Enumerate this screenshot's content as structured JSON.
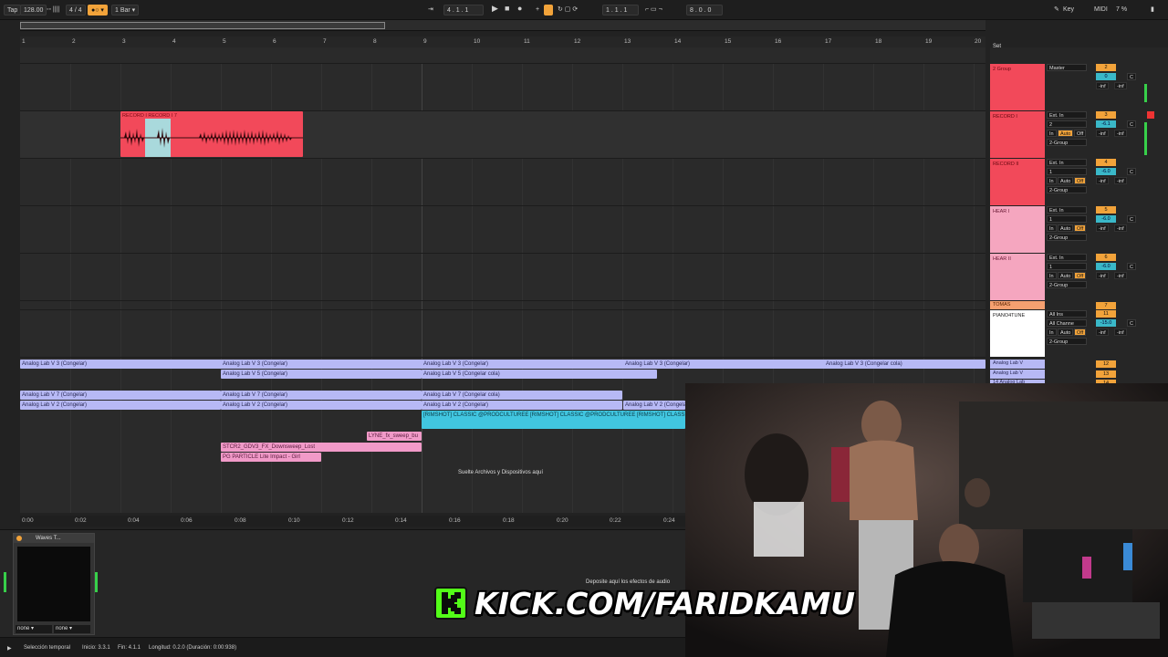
{
  "toolbar": {
    "tap": "Tap",
    "tempo": "128.00",
    "signature": "4 / 4",
    "quantize": "1 Bar",
    "position": "4 .  1 .  1",
    "loop_start": "1 .  1 .  1",
    "loop_length": "8 .  0 .  0",
    "key": "Key",
    "midi": "MIDI",
    "cpu": "7 %"
  },
  "ruler_bars": [
    "1",
    "2",
    "3",
    "4",
    "5",
    "6",
    "7",
    "8",
    "9",
    "10",
    "11",
    "12",
    "13",
    "14",
    "15",
    "16",
    "17",
    "18",
    "19",
    "20"
  ],
  "time_ticks": [
    "0:00",
    "0:02",
    "0:04",
    "0:06",
    "0:08",
    "0:10",
    "0:12",
    "0:14",
    "0:16",
    "0:18",
    "0:20",
    "0:22",
    "0:24"
  ],
  "set_label": "Set",
  "record_clip": {
    "header": "RECORD I RECORD I 7"
  },
  "clips": [
    {
      "text": "Analog Lab V 3 (Congelar)"
    },
    {
      "text": "Analog Lab V 3 (Congelar)"
    },
    {
      "text": "Analog Lab V 3 (Congelar)"
    },
    {
      "text": "Analog Lab V 3 (Congelar)"
    },
    {
      "text": "Analog Lab V 3 (Congelar cola)"
    },
    {
      "text": "Analog Lab V 5 (Congelar)"
    },
    {
      "text": "Analog Lab V 5 (Congelar cola)"
    },
    {
      "text": "Analog Lab V 7 (Congelar)"
    },
    {
      "text": "Analog Lab V 7 (Congelar)"
    },
    {
      "text": "Analog Lab V 7 (Congelar cola)"
    },
    {
      "text": "Analog Lab V 2 (Congelar)"
    },
    {
      "text": "Analog Lab V 2 (Congelar)"
    },
    {
      "text": "Analog Lab V 2 (Congelar)"
    },
    {
      "text": "Analog Lab V 2 (Congelar)"
    },
    {
      "text": "[RIMSHOT] CLASSIC @PRODCULTUREE [RIMSHOT] CLASSIC @PRODCULTUREE [RIMSHOT] CLASSIC @P"
    },
    {
      "text": "LYNE_fx_sweep_bu"
    },
    {
      "text": "STCR2_GDV3_FX_Downsweep_Lost"
    },
    {
      "text": "PG PARTICLE Lite Impact - Girl"
    }
  ],
  "drop_files": "Suelte Archivos y Dispositivos aquí",
  "drop_effects": "Deposite aquí los efectos de audio",
  "tracks": [
    {
      "name": "2 Group",
      "routing": "Master",
      "num": "2",
      "vol": "0",
      "pan": "C",
      "inf1": "-inf",
      "inf2": "-inf"
    },
    {
      "name": "RECORD I",
      "routing": "Ext. In",
      "ch": "2",
      "num": "3",
      "vol": "-6.1",
      "pan": "C",
      "mon_in": "In",
      "mon_auto": "Auto",
      "mon_off": "Off",
      "out": "2-Group",
      "inf1": "-inf",
      "inf2": "-inf"
    },
    {
      "name": "RECORD II",
      "routing": "Ext. In",
      "ch": "1",
      "num": "4",
      "vol": "-6.0",
      "pan": "C",
      "mon_in": "In",
      "mon_auto": "Auto",
      "mon_off": "Off",
      "out": "2-Group",
      "inf1": "-inf",
      "inf2": "-inf"
    },
    {
      "name": "HEAR I",
      "routing": "Ext. In",
      "ch": "1",
      "num": "5",
      "vol": "-6.0",
      "pan": "C",
      "mon_in": "In",
      "mon_auto": "Auto",
      "mon_off": "Off",
      "out": "2-Group",
      "inf1": "-inf",
      "inf2": "-inf"
    },
    {
      "name": "HEAR II",
      "routing": "Ext. In",
      "ch": "1",
      "num": "6",
      "vol": "-6.0",
      "pan": "C",
      "mon_in": "In",
      "mon_auto": "Auto",
      "mon_off": "Off",
      "out": "2-Group",
      "inf1": "-inf",
      "inf2": "-inf"
    },
    {
      "name": "TOMAS",
      "num": "7"
    },
    {
      "name": "PIANO4TUNE",
      "routing": "All Ins",
      "ch": "All Channe",
      "num": "11",
      "vol": "-15.0",
      "pan": "C",
      "mon_in": "In",
      "mon_auto": "Auto",
      "mon_off": "Off",
      "out": "2-Group",
      "inf1": "-inf",
      "inf2": "-inf"
    }
  ],
  "small_tracks": [
    {
      "name": "Analog Lab V",
      "num": "12"
    },
    {
      "name": "Analog Lab V",
      "num": "13"
    },
    {
      "name": "14 Analog Lab",
      "num": "14"
    }
  ],
  "device": {
    "name": "Waves T...",
    "sel1": "none",
    "sel2": "none"
  },
  "status": {
    "sel": "Selección temporal",
    "inicio": "Inicio: 3.3.1",
    "fin": "Fin: 4.1.1",
    "longitud": "Longitud: 0.2.0  (Duración: 0:00:938)"
  },
  "overlay": {
    "url": "KICK.COM/FARIDKAMU"
  },
  "colors": {
    "record": "#f2495a",
    "hear": "#f5a6bf",
    "lavender": "#b7b9f5",
    "cyan": "#41c6e0",
    "pink": "#f19ac8",
    "kick": "#53fc18",
    "orange": "#f2a33a"
  }
}
